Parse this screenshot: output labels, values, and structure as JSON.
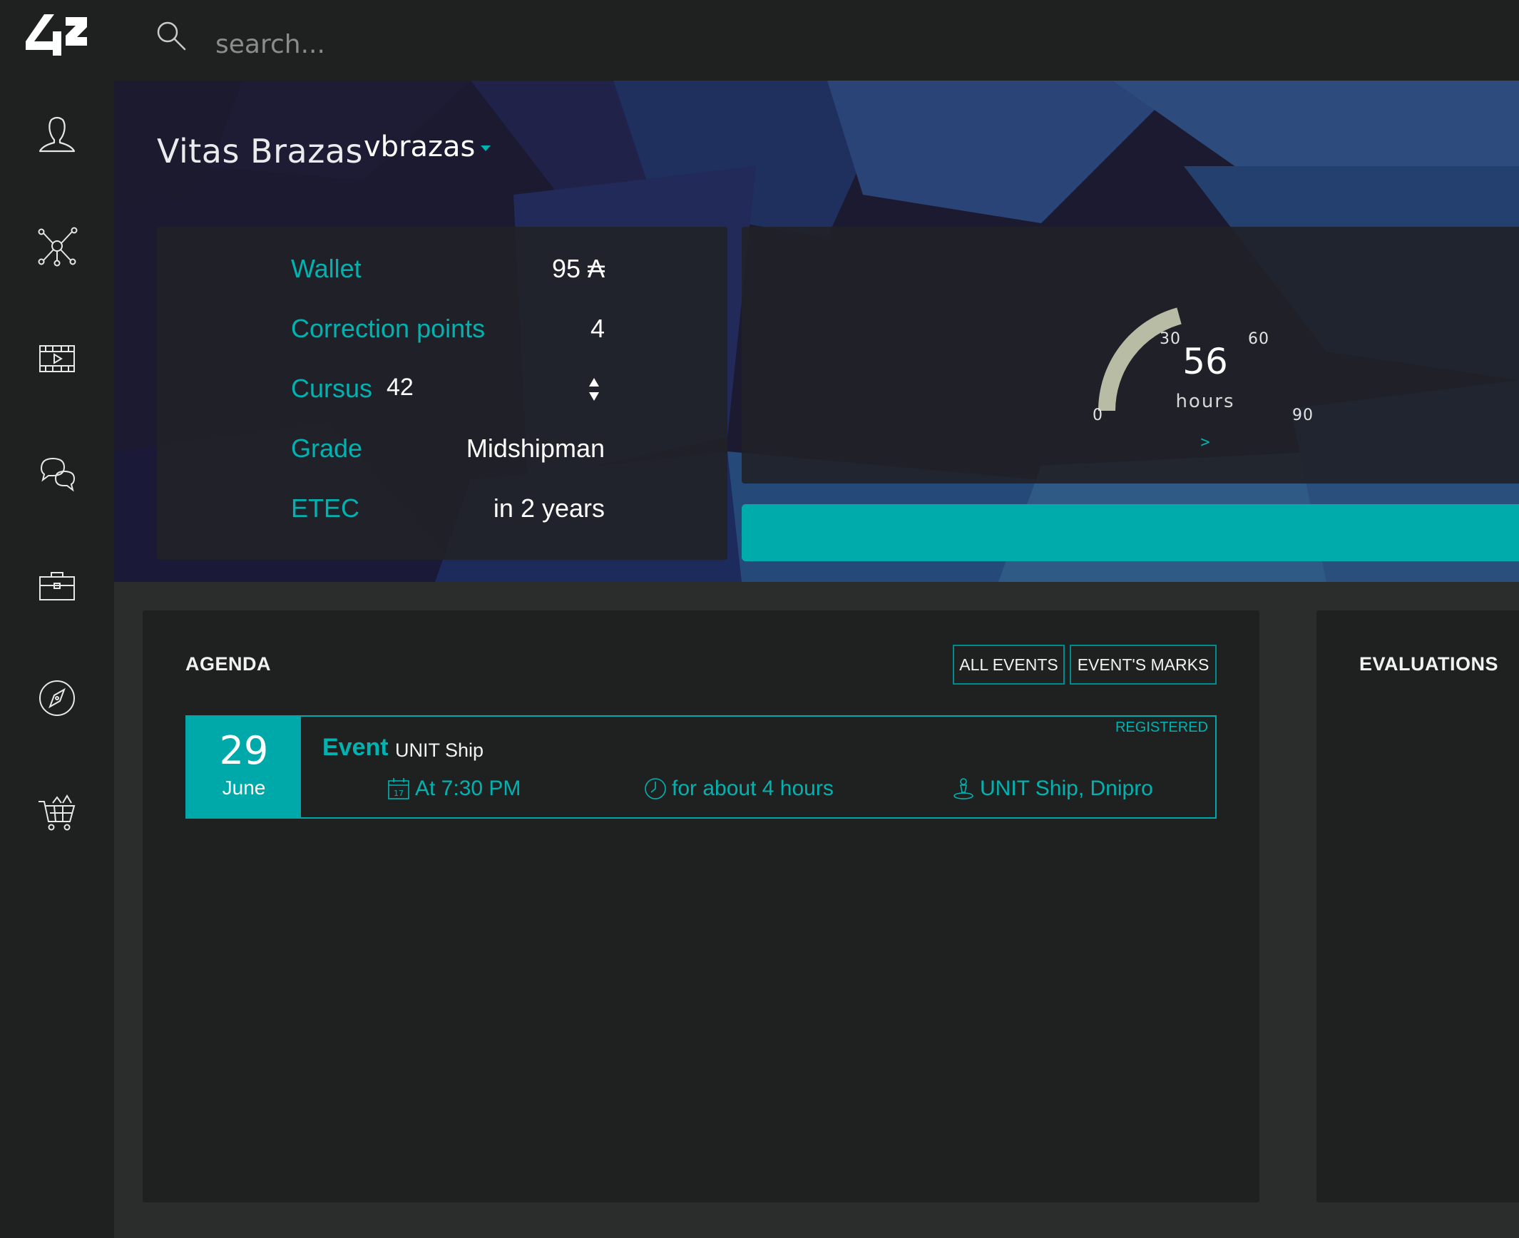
{
  "brand": {
    "logo_text": "42"
  },
  "search": {
    "placeholder": "search..."
  },
  "sidebar": {
    "items": [
      {
        "name": "profile",
        "icon": "user-icon"
      },
      {
        "name": "holy-graph",
        "icon": "network-icon"
      },
      {
        "name": "elearning",
        "icon": "film-icon"
      },
      {
        "name": "forum",
        "icon": "chat-icon"
      },
      {
        "name": "companies",
        "icon": "briefcase-icon"
      },
      {
        "name": "explore",
        "icon": "compass-icon"
      },
      {
        "name": "shop",
        "icon": "cart-icon"
      }
    ]
  },
  "user": {
    "full_name": "Vitas Brazas",
    "login": "vbrazas"
  },
  "info": {
    "wallet_label": "Wallet",
    "wallet_value": "95 ₳",
    "correction_label": "Correction points",
    "correction_value": "4",
    "cursus_label": "Cursus",
    "cursus_value": "42",
    "grade_label": "Grade",
    "grade_value": "Midshipman",
    "etec_label": "ETEC",
    "etec_value": "in 2 years"
  },
  "logtime": {
    "value": "56",
    "value_number": 56,
    "max": 90,
    "unit": "hours",
    "ticks": [
      "0",
      "30",
      "60",
      "90"
    ],
    "next_label": ">"
  },
  "level": {
    "progress": 1.0
  },
  "agenda": {
    "title": "AGENDA",
    "all_events_label": "ALL EVENTS",
    "event_marks_label": "EVENT'S MARKS",
    "events": [
      {
        "day": "29",
        "month": "June",
        "kind": "Event",
        "name": "UNIT Ship",
        "status": "REGISTERED",
        "calendar_day": "17",
        "time": "At 7:30 PM",
        "duration": "for about 4 hours",
        "location": "UNIT Ship, Dnipro"
      }
    ]
  },
  "evaluations": {
    "title": "EVALUATIONS"
  },
  "colors": {
    "accent": "#00b3b0",
    "background": "#2b2c2c",
    "panel": "#1f2121",
    "gauge": "#b9bca4"
  }
}
